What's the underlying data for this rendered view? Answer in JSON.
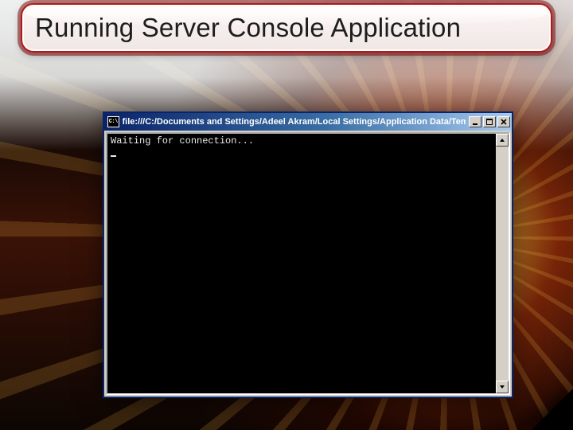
{
  "slide": {
    "title": "Running Server Console Application"
  },
  "console": {
    "app_icon_text": "C:\\",
    "title_path": "file:///C:/Documents and Settings/Adeel Akram/Local Settings/Application Data/Temporary …",
    "output_line": "Waiting for connection...",
    "minimize_label": "minimize",
    "maximize_label": "maximize",
    "close_label": "close",
    "scroll_up_label": "scroll up",
    "scroll_down_label": "scroll down"
  }
}
